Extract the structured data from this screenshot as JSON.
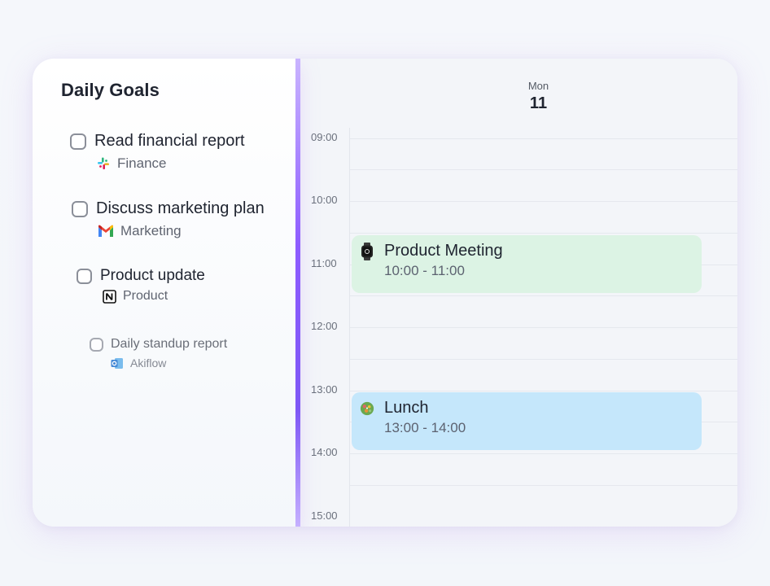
{
  "goals": {
    "title": "Daily Goals",
    "tasks": [
      {
        "label": "Read financial report",
        "tag": "Finance",
        "tag_icon": "slack-icon"
      },
      {
        "label": "Discuss marketing plan",
        "tag": "Marketing",
        "tag_icon": "gmail-icon"
      },
      {
        "label": "Product update",
        "tag": "Product",
        "tag_icon": "notion-icon"
      },
      {
        "label": "Daily standup report",
        "tag": "Akiflow",
        "tag_icon": "outlook-icon"
      }
    ]
  },
  "calendar": {
    "day_name": "Mon",
    "day_number": "11",
    "times": [
      "09:00",
      "10:00",
      "11:00",
      "12:00",
      "13:00",
      "14:00",
      "15:00"
    ],
    "events": [
      {
        "title": "Product Meeting",
        "time": "10:00 - 11:00",
        "icon": "watch-icon",
        "color": "#dcf3e4"
      },
      {
        "title": "Lunch",
        "time": "13:00 - 14:00",
        "icon": "salad-icon",
        "color": "#c5e7fb"
      }
    ]
  },
  "colors": {
    "accent": "#8d5cff",
    "meeting_bg": "#dcf3e4",
    "lunch_bg": "#c5e7fb"
  }
}
